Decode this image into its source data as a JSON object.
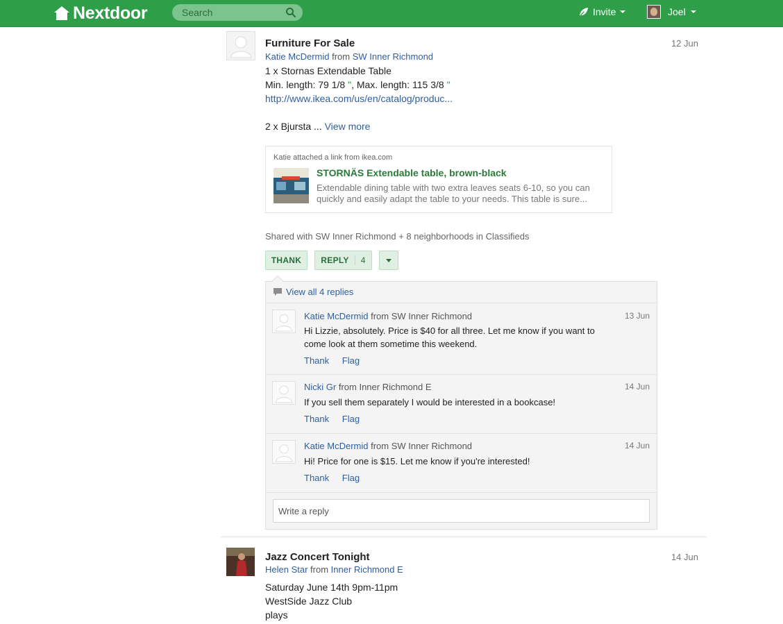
{
  "nav": {
    "logo_text": "Nextdoor",
    "search_placeholder": "Search",
    "invite_label": "Invite",
    "user_name": "Joel",
    "brand_color": "#2f9e49"
  },
  "post1": {
    "title": "Furniture For Sale",
    "author": "Katie McDermid",
    "from_word": "from",
    "neighborhood": "SW Inner Richmond",
    "date": "12 Jun",
    "body_line1": "1 x Stornas Extendable Table",
    "body_line2_a": "Min. length: 79 1/8",
    "body_line2_q1": "\"",
    "body_line2_b": ", Max. length: 115 3/8",
    "body_line2_q2": "\"",
    "body_link": "http://www.ikea.com/us/en/catalog/produc...",
    "body_line4": "2 x Bjursta ...",
    "view_more": "View more",
    "link_card": {
      "from": "Katie attached a link from ikea.com",
      "title": "STORNÄS Extendable table, brown-black",
      "description": "Extendable dining table with two extra leaves seats 6-10, so you can quickly and easily adapt the table to your needs. This table is sure..."
    },
    "shared": "Shared with SW Inner Richmond + 8 neighborhoods in Classifieds",
    "thank_label": "THANK",
    "reply_label": "REPLY",
    "reply_count": "4",
    "view_all": "View all 4 replies",
    "replies": [
      {
        "author": "Katie McDermid",
        "from": "from SW Inner Richmond",
        "date": "13 Jun",
        "text": "Hi Lizzie, absolutely. Price is $40 for all three. Let me know if you want to come look at them sometime this weekend."
      },
      {
        "author": "Nicki Gr",
        "from": "from Inner Richmond E",
        "date": "14 Jun",
        "text": "If you sell them separately I would be interested in a bookcase!"
      },
      {
        "author": "Katie McDermid",
        "from": "from SW Inner Richmond",
        "date": "14 Jun",
        "text": "Hi! Price for one is $15. Let me know if you're interested!"
      }
    ],
    "thank_link": "Thank",
    "flag_link": "Flag",
    "reply_placeholder": "Write a reply"
  },
  "post2": {
    "title": "Jazz Concert Tonight",
    "author": "Helen Star",
    "from_word": "from",
    "neighborhood": "Inner Richmond E",
    "date": "14 Jun",
    "body_lines": [
      "Saturday June 14th 9pm-11pm",
      "WestSide Jazz Club",
      "plays"
    ]
  }
}
